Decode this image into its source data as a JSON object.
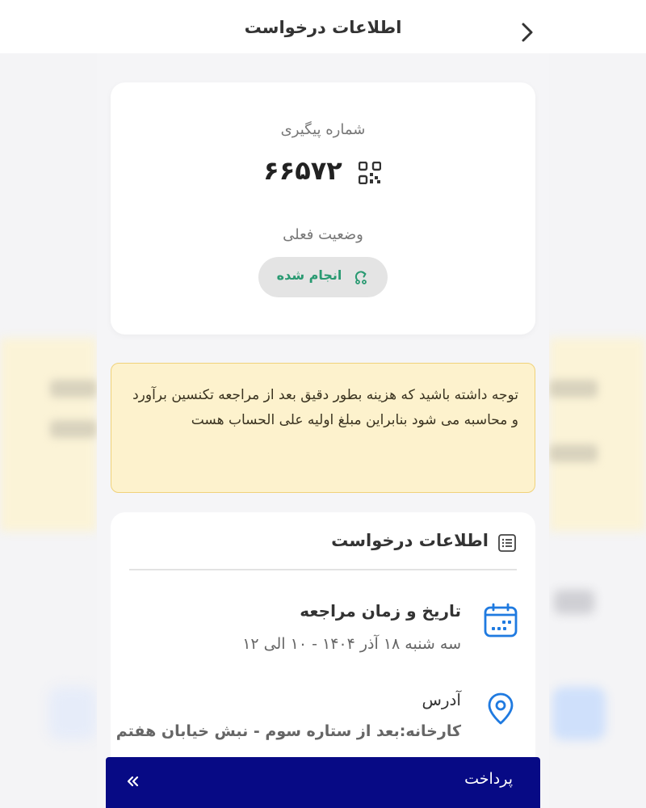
{
  "header": {
    "title": "اطلاعات درخواست"
  },
  "tracking": {
    "label": "شماره پیگیری",
    "number": "۶۶۵۷۲"
  },
  "status": {
    "label": "وضعیت فعلی",
    "value": "انجام شده"
  },
  "notice": {
    "text": "توجه داشته باشید که هزینه بطور دقیق بعد از مراجعه تکنسین برآورد و محاسبه می شود بنابراین مبلغ اولیه علی الحساب هست"
  },
  "info": {
    "title": "اطلاعات درخواست",
    "date": {
      "title": "تاریخ و زمان مراجعه",
      "value": "سه شنبه ۱۸ آذر ۱۴۰۴ - ۱۰ الی ۱۲"
    },
    "address": {
      "title": "آدرس",
      "value": "کارخانه:بعد از ستاره سوم - نبش خیابان هفتم"
    }
  },
  "payment": {
    "label": "پرداخت"
  },
  "colors": {
    "primary": "#070a85",
    "status_green": "#2a9a72",
    "notice_bg": "#fdf2cd",
    "notice_border": "#f0d27a",
    "icon_blue": "#1f7ae0"
  },
  "icons": [
    "back-chevron-icon",
    "qr-code-icon",
    "status-refresh-icon",
    "list-icon",
    "calendar-icon",
    "location-pin-icon",
    "double-chevron-left-icon"
  ]
}
